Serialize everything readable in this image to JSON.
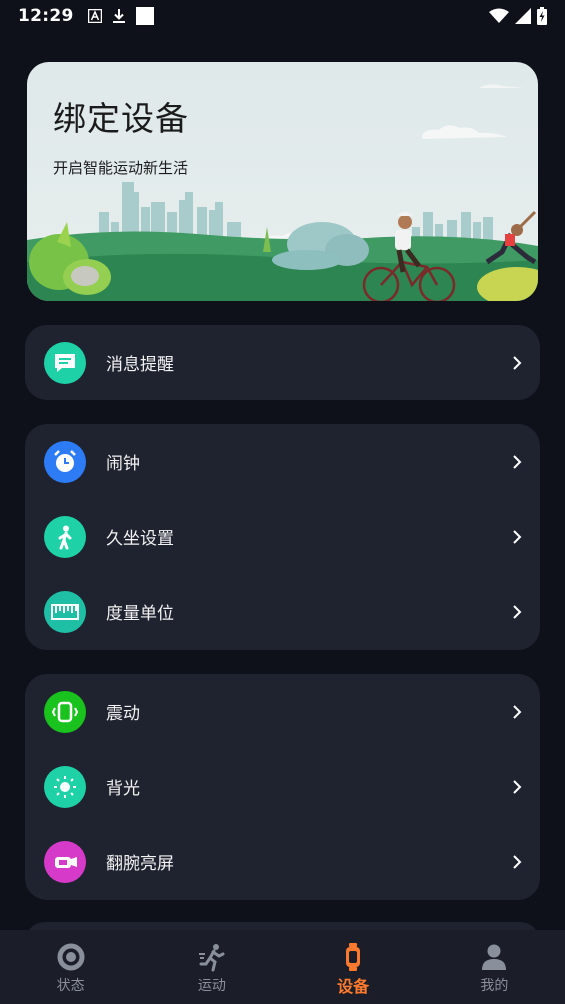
{
  "status_bar": {
    "time": "12:29"
  },
  "banner": {
    "title": "绑定设备",
    "subtitle": "开启智能运动新生活"
  },
  "menu": {
    "notifications": {
      "label": "消息提醒",
      "icon": "message-icon",
      "color": "#1fd1a6"
    },
    "alarm": {
      "label": "闹钟",
      "icon": "alarm-clock-icon",
      "color": "#2d7cf6"
    },
    "sedentary": {
      "label": "久坐设置",
      "icon": "standing-person-icon",
      "color": "#1fd1a6"
    },
    "units": {
      "label": "度量单位",
      "icon": "ruler-icon",
      "color": "#1fbfa6"
    },
    "vibration": {
      "label": "震动",
      "icon": "watch-vibrate-icon",
      "color": "#19c21d"
    },
    "backlight": {
      "label": "背光",
      "icon": "sun-icon",
      "color": "#1fd1a6"
    },
    "raise_to_wake": {
      "label": "翻腕亮屏",
      "icon": "wrist-raise-icon",
      "color": "#d63ac8"
    }
  },
  "bottom_nav": {
    "items": [
      {
        "label": "状态",
        "icon": "status-ring-icon",
        "active": false
      },
      {
        "label": "运动",
        "icon": "running-icon",
        "active": false
      },
      {
        "label": "设备",
        "icon": "watch-icon",
        "active": true
      },
      {
        "label": "我的",
        "icon": "profile-icon",
        "active": false
      }
    ],
    "active_color": "#ff7a2e",
    "inactive_color": "#8a8f9c"
  }
}
